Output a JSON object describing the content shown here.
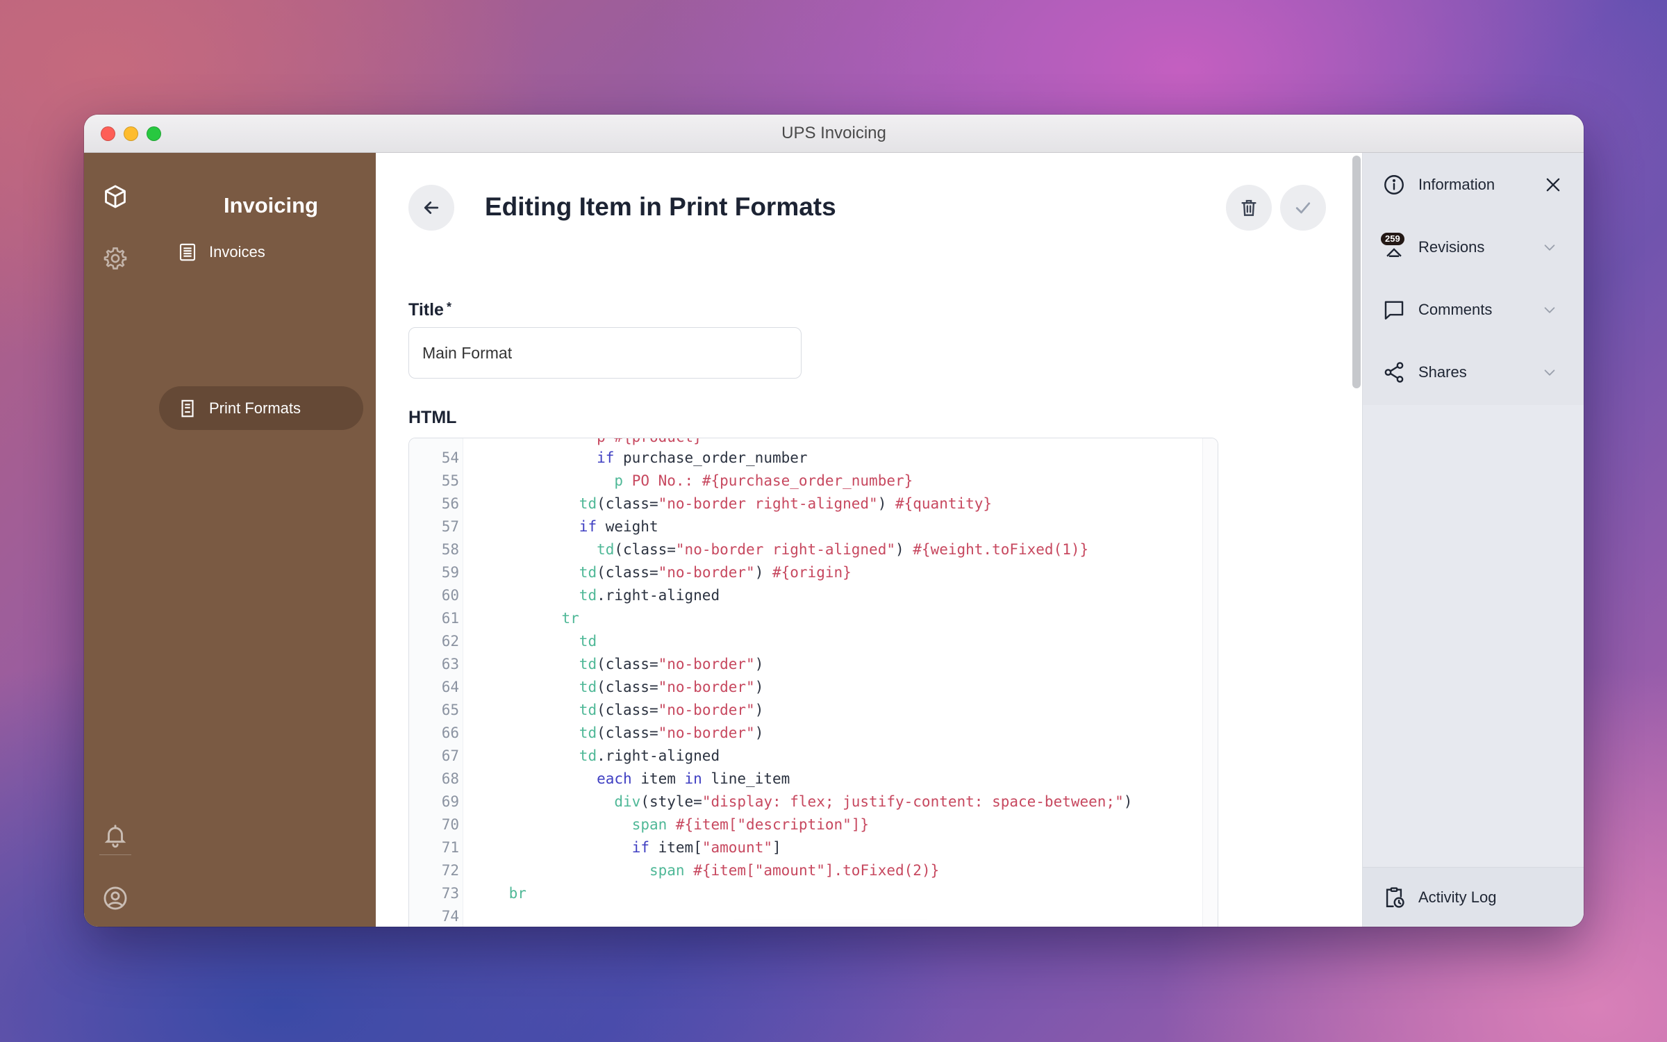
{
  "window": {
    "title": "UPS Invoicing"
  },
  "nav": {
    "app_title": "Invoicing",
    "items": [
      {
        "label": "Invoices"
      },
      {
        "label": "Print Formats"
      }
    ]
  },
  "header": {
    "title": "Editing Item in Print Formats"
  },
  "form": {
    "title_label": "Title",
    "required_mark": "*",
    "title_value": "Main Format",
    "html_label": "HTML"
  },
  "editor": {
    "partial_top": "p #{product}",
    "lines": [
      {
        "n": "54",
        "indent": 7,
        "segs": [
          [
            "kw",
            "if"
          ],
          [
            "plain",
            " purchase_order_number"
          ]
        ]
      },
      {
        "n": "55",
        "indent": 8,
        "segs": [
          [
            "tag",
            "p"
          ],
          [
            "txt",
            " PO No.: #{purchase_order_number}"
          ]
        ]
      },
      {
        "n": "56",
        "indent": 6,
        "segs": [
          [
            "tag",
            "td"
          ],
          [
            "plain",
            "(class="
          ],
          [
            "str",
            "\"no-border right-aligned\""
          ],
          [
            "plain",
            ") "
          ],
          [
            "ip",
            "#{quantity}"
          ]
        ]
      },
      {
        "n": "57",
        "indent": 6,
        "segs": [
          [
            "kw",
            "if"
          ],
          [
            "plain",
            " weight"
          ]
        ]
      },
      {
        "n": "58",
        "indent": 7,
        "segs": [
          [
            "tag",
            "td"
          ],
          [
            "plain",
            "(class="
          ],
          [
            "str",
            "\"no-border right-aligned\""
          ],
          [
            "plain",
            ") "
          ],
          [
            "ip",
            "#{weight.toFixed(1)}"
          ]
        ]
      },
      {
        "n": "59",
        "indent": 6,
        "segs": [
          [
            "tag",
            "td"
          ],
          [
            "plain",
            "(class="
          ],
          [
            "str",
            "\"no-border\""
          ],
          [
            "plain",
            ") "
          ],
          [
            "ip",
            "#{origin}"
          ]
        ]
      },
      {
        "n": "60",
        "indent": 6,
        "segs": [
          [
            "tag",
            "td"
          ],
          [
            "plain",
            ".right-aligned"
          ]
        ]
      },
      {
        "n": "61",
        "indent": 5,
        "segs": [
          [
            "tag",
            "tr"
          ]
        ]
      },
      {
        "n": "62",
        "indent": 6,
        "segs": [
          [
            "tag",
            "td"
          ]
        ]
      },
      {
        "n": "63",
        "indent": 6,
        "segs": [
          [
            "tag",
            "td"
          ],
          [
            "plain",
            "(class="
          ],
          [
            "str",
            "\"no-border\""
          ],
          [
            "plain",
            ")"
          ]
        ]
      },
      {
        "n": "64",
        "indent": 6,
        "segs": [
          [
            "tag",
            "td"
          ],
          [
            "plain",
            "(class="
          ],
          [
            "str",
            "\"no-border\""
          ],
          [
            "plain",
            ")"
          ]
        ]
      },
      {
        "n": "65",
        "indent": 6,
        "segs": [
          [
            "tag",
            "td"
          ],
          [
            "plain",
            "(class="
          ],
          [
            "str",
            "\"no-border\""
          ],
          [
            "plain",
            ")"
          ]
        ]
      },
      {
        "n": "66",
        "indent": 6,
        "segs": [
          [
            "tag",
            "td"
          ],
          [
            "plain",
            "(class="
          ],
          [
            "str",
            "\"no-border\""
          ],
          [
            "plain",
            ")"
          ]
        ]
      },
      {
        "n": "67",
        "indent": 6,
        "segs": [
          [
            "tag",
            "td"
          ],
          [
            "plain",
            ".right-aligned"
          ]
        ]
      },
      {
        "n": "68",
        "indent": 7,
        "segs": [
          [
            "kw",
            "each"
          ],
          [
            "plain",
            " item "
          ],
          [
            "kw",
            "in"
          ],
          [
            "plain",
            " line_item"
          ]
        ]
      },
      {
        "n": "69",
        "indent": 8,
        "segs": [
          [
            "tag",
            "div"
          ],
          [
            "plain",
            "(style="
          ],
          [
            "str",
            "\"display: flex; justify-content: space-between;\""
          ],
          [
            "plain",
            ")"
          ]
        ]
      },
      {
        "n": "70",
        "indent": 9,
        "segs": [
          [
            "tag",
            "span"
          ],
          [
            "ip",
            " #{item[\"description\"]}"
          ]
        ]
      },
      {
        "n": "71",
        "indent": 9,
        "segs": [
          [
            "kw",
            "if"
          ],
          [
            "plain",
            " item["
          ],
          [
            "str",
            "\"amount\""
          ],
          [
            "plain",
            "]"
          ]
        ]
      },
      {
        "n": "72",
        "indent": 10,
        "segs": [
          [
            "tag",
            "span"
          ],
          [
            "ip",
            " #{item[\"amount\"].toFixed(2)}"
          ]
        ]
      },
      {
        "n": "73",
        "indent": 2,
        "segs": [
          [
            "tag",
            "br"
          ]
        ]
      },
      {
        "n": "74",
        "indent": 0,
        "segs": []
      }
    ]
  },
  "panel": {
    "information_label": "Information",
    "revisions_label": "Revisions",
    "revisions_count": "259",
    "comments_label": "Comments",
    "shares_label": "Shares",
    "activity_label": "Activity Log"
  },
  "colors": {
    "sidebar": "#7a5a43",
    "sidebar_active": "#654936",
    "tag": "#4fb897",
    "keyword": "#3f3fc2",
    "string": "#c7485f"
  }
}
